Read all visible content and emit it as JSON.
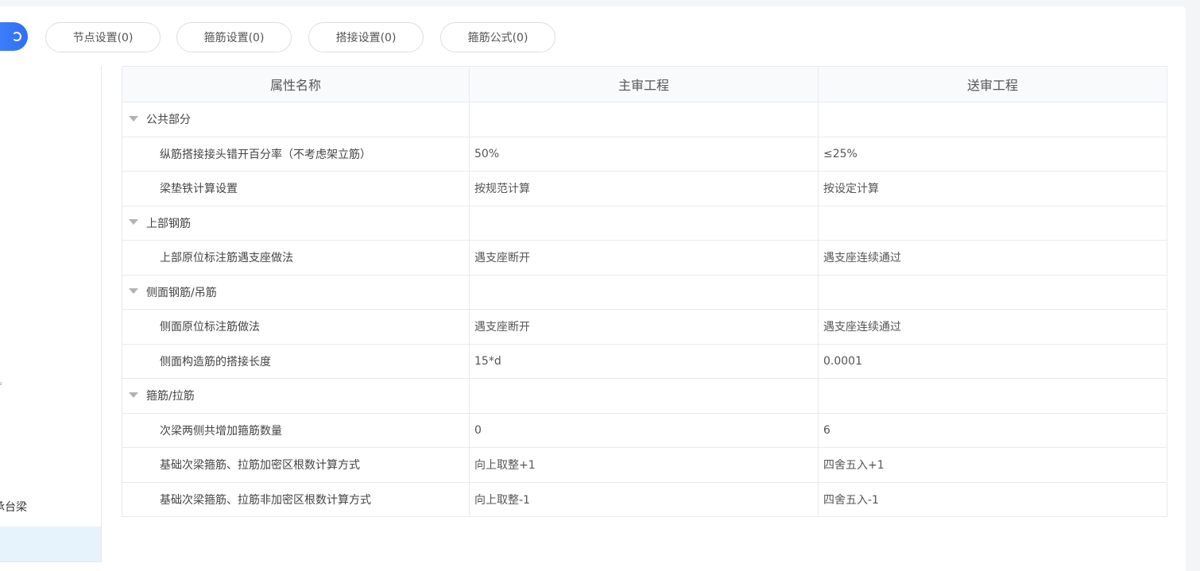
{
  "tabs": [
    {
      "label": "节点设置(0)"
    },
    {
      "label": "箍筋设置(0)"
    },
    {
      "label": "搭接设置(0)"
    },
    {
      "label": "箍筋公式(0)"
    }
  ],
  "left_tree": {
    "mark": "。",
    "partial_item": "承台梁"
  },
  "table": {
    "headers": [
      "属性名称",
      "主审工程",
      "送审工程"
    ],
    "rows": [
      {
        "type": "group",
        "name": "公共部分",
        "main": "",
        "review": ""
      },
      {
        "type": "item",
        "name": "纵筋搭接接头错开百分率（不考虑架立筋）",
        "main": "50%",
        "review": "≤25%"
      },
      {
        "type": "item",
        "name": "梁垫铁计算设置",
        "main": "按规范计算",
        "review": "按设定计算"
      },
      {
        "type": "group",
        "name": "上部钢筋",
        "main": "",
        "review": ""
      },
      {
        "type": "item",
        "name": "上部原位标注筋遇支座做法",
        "main": "遇支座断开",
        "review": "遇支座连续通过"
      },
      {
        "type": "group",
        "name": "侧面钢筋/吊筋",
        "main": "",
        "review": ""
      },
      {
        "type": "item",
        "name": "侧面原位标注筋做法",
        "main": "遇支座断开",
        "review": "遇支座连续通过"
      },
      {
        "type": "item",
        "name": "侧面构造筋的搭接长度",
        "main": "15*d",
        "review": "0.0001"
      },
      {
        "type": "group",
        "name": "箍筋/拉筋",
        "main": "",
        "review": ""
      },
      {
        "type": "item",
        "name": "次梁两侧共增加箍筋数量",
        "main": "0",
        "review": "6"
      },
      {
        "type": "item",
        "name": "基础次梁箍筋、拉筋加密区根数计算方式",
        "main": "向上取整+1",
        "review": "四舍五入+1"
      },
      {
        "type": "item",
        "name": "基础次梁箍筋、拉筋非加密区根数计算方式",
        "main": "向上取整-1",
        "review": "四舍五入-1"
      }
    ]
  },
  "colors": {
    "accent": "#3478f6",
    "selected_bg": "#e7f3fc",
    "header_bg": "#f9fafc",
    "border": "#e8eaee"
  }
}
